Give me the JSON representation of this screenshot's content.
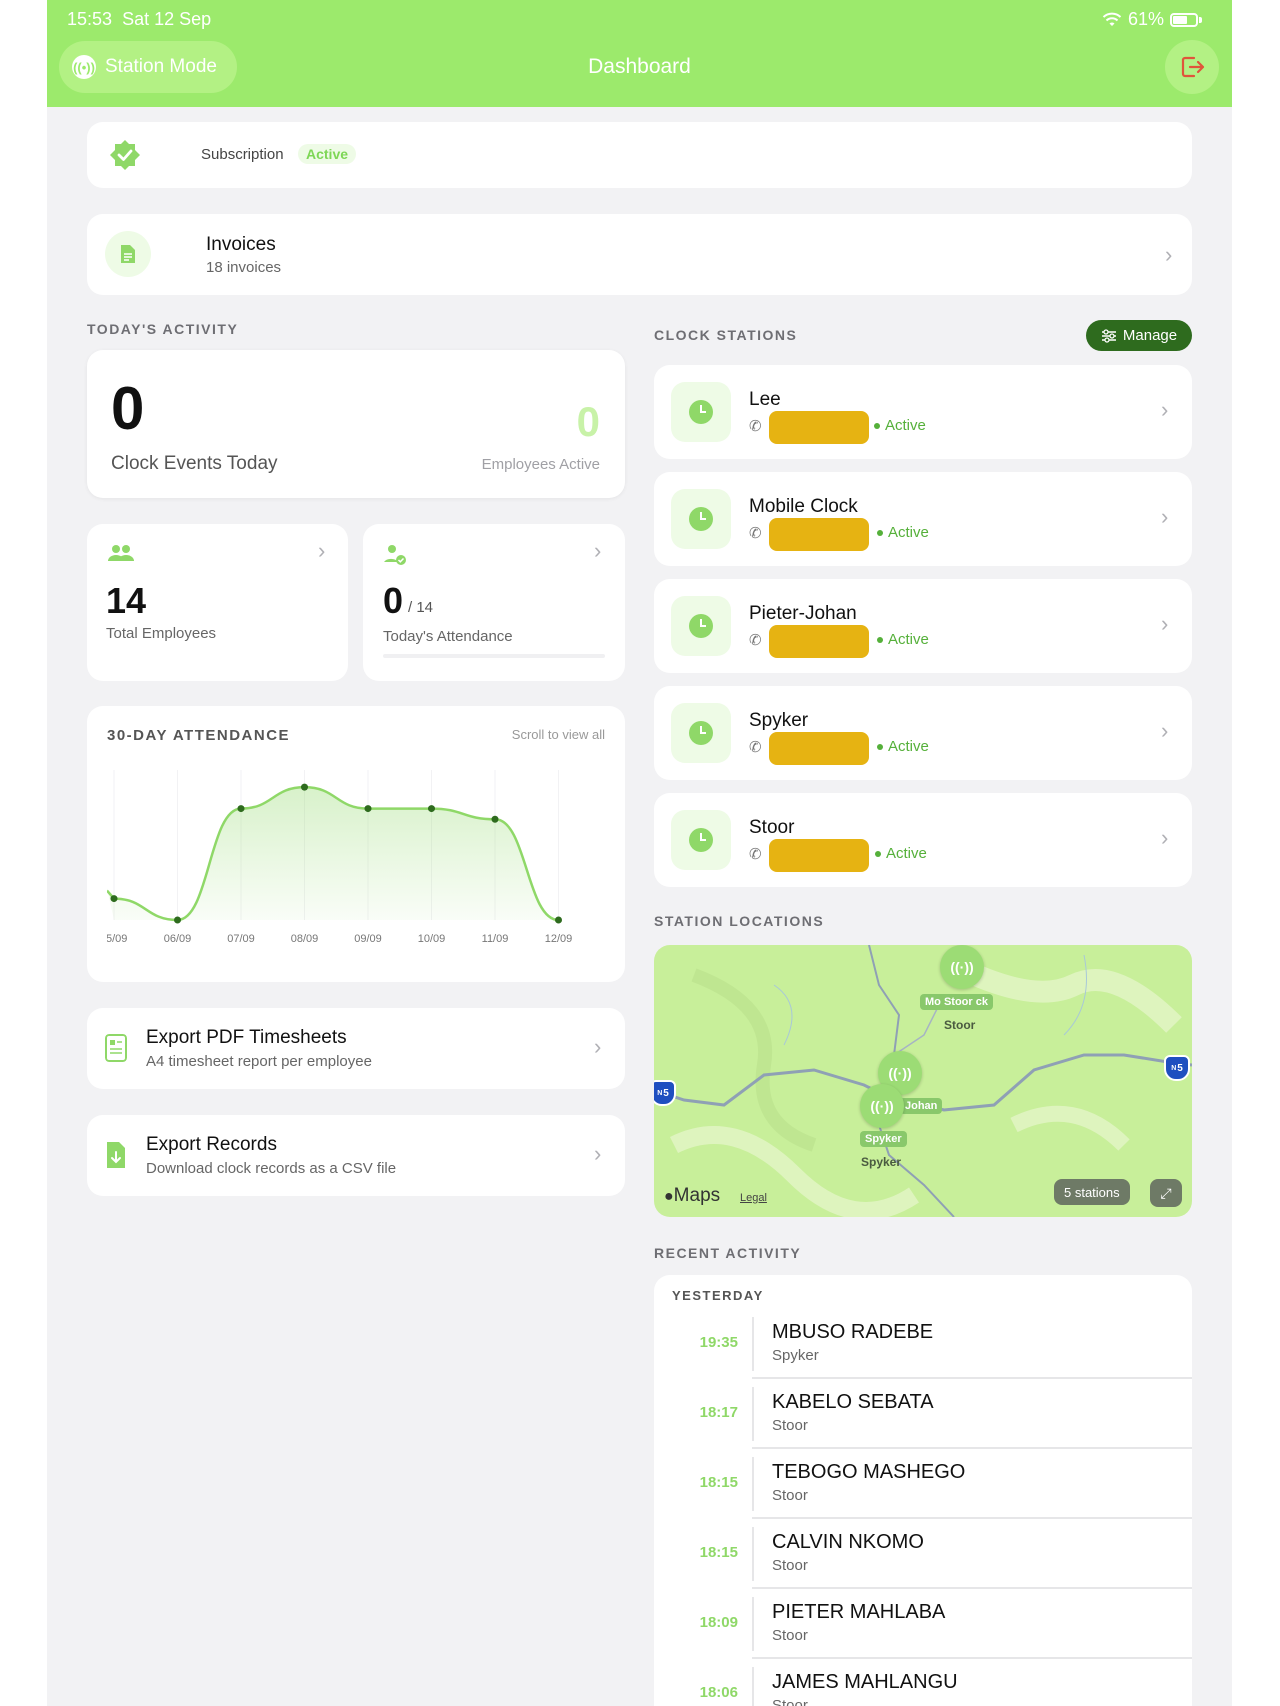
{
  "status_bar": {
    "time": "15:53",
    "date": "Sat 12 Sep",
    "battery": "61%"
  },
  "header": {
    "station_mode": "Station Mode",
    "title": "Dashboard"
  },
  "subscription": {
    "label": "Subscription",
    "status": "Active"
  },
  "invoices": {
    "title": "Invoices",
    "subtitle": "18 invoices"
  },
  "todays_activity": {
    "label": "TODAY'S ACTIVITY",
    "clock_events": "0",
    "clock_events_label": "Clock Events Today",
    "employees_active": "0",
    "employees_active_label": "Employees Active"
  },
  "employees": {
    "total": "14",
    "label": "Total Employees"
  },
  "attendance": {
    "present": "0",
    "of": "/ 14",
    "label": "Today's Attendance",
    "progress": 0
  },
  "chart": {
    "title": "30-DAY ATTENDANCE",
    "hint": "Scroll to view all"
  },
  "chart_data": {
    "type": "area",
    "categories": [
      "05/09",
      "06/09",
      "07/09",
      "08/09",
      "09/09",
      "10/09",
      "11/09",
      "12/09"
    ],
    "tick_labels": [
      "5/09",
      "06/09",
      "07/09",
      "08/09",
      "09/09",
      "10/09",
      "11/09",
      "12/09"
    ],
    "values": [
      1,
      0,
      5.2,
      6.2,
      5.2,
      5.2,
      4.7,
      0
    ],
    "title": "30-DAY ATTENDANCE",
    "xlabel": "",
    "ylabel": "",
    "ylim": [
      0,
      7
    ],
    "grid": true,
    "color": "#8fd868"
  },
  "exports": [
    {
      "title": "Export PDF Timesheets",
      "subtitle": "A4 timesheet report per employee"
    },
    {
      "title": "Export Records",
      "subtitle": "Download clock records as a CSV file"
    }
  ],
  "clock_stations": {
    "label": "CLOCK STATIONS",
    "manage": "Manage",
    "items": [
      {
        "name": "Lee",
        "status": "Active"
      },
      {
        "name": "Mobile Clock",
        "status": "Active"
      },
      {
        "name": "Pieter-Johan",
        "status": "Active"
      },
      {
        "name": "Spyker",
        "status": "Active"
      },
      {
        "name": "Stoor",
        "status": "Active"
      }
    ]
  },
  "map": {
    "label": "STATION LOCATIONS",
    "pin_tag_top": "Mo Stoor ck",
    "pin_label_top": "Stoor",
    "pin_tag_mid": "Johan",
    "pin_tag_bottom": "Spyker",
    "pin_label_bottom": "Spyker",
    "route_badge": "5",
    "route_badge_prefix": "N",
    "logo": "Maps",
    "legal": "Legal",
    "stations_count": "5 stations"
  },
  "recent_activity": {
    "label": "RECENT ACTIVITY",
    "group": "YESTERDAY",
    "items": [
      {
        "time": "19:35",
        "name": "MBUSO RADEBE",
        "place": "Spyker"
      },
      {
        "time": "18:17",
        "name": "KABELO SEBATA",
        "place": "Stoor"
      },
      {
        "time": "18:15",
        "name": "TEBOGO MASHEGO",
        "place": "Stoor"
      },
      {
        "time": "18:15",
        "name": "CALVIN NKOMO",
        "place": "Stoor"
      },
      {
        "time": "18:09",
        "name": "PIETER MAHLABA",
        "place": "Stoor"
      },
      {
        "time": "18:06",
        "name": "JAMES MAHLANGU",
        "place": "Stoor"
      }
    ]
  }
}
